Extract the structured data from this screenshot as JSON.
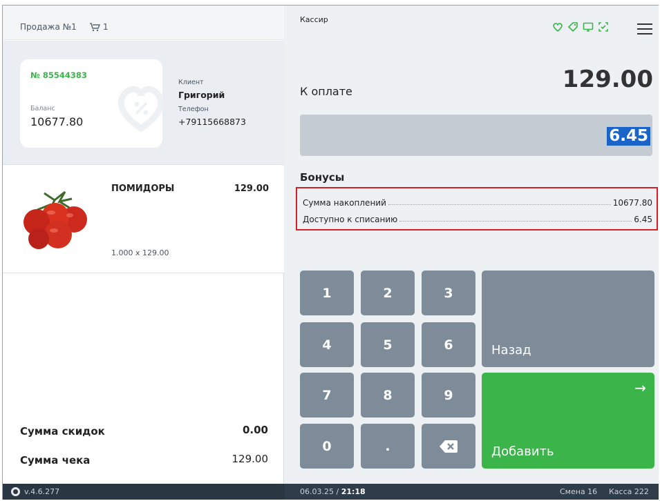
{
  "left": {
    "sale_title": "Продажа №1",
    "cart_count": "1",
    "card": {
      "number": "№ 85544383",
      "balance_label": "Баланс",
      "balance": "10677.80"
    },
    "client": {
      "label": "Клиент",
      "name": "Григорий",
      "phone_label": "Телефон",
      "phone": "+79115668873"
    },
    "item": {
      "name": "ПОМИДОРЫ",
      "price": "129.00",
      "qty": "1.000 x 129.00"
    },
    "sum_discount_label": "Сумма скидок",
    "sum_discount_value": "0.00",
    "sum_check_label": "Сумма чека",
    "sum_check_value": "129.00"
  },
  "right": {
    "cashier": "Кассир",
    "pay_label": "К оплате",
    "pay_total": "129.00",
    "bonus_input": "6.45",
    "bonuses_title": "Бонусы",
    "accum_label": "Сумма накоплений",
    "accum_value": "10677.80",
    "avail_label": "Доступно к списанию",
    "avail_value": "6.45",
    "keys": [
      "1",
      "2",
      "3",
      "4",
      "5",
      "6",
      "7",
      "8",
      "9",
      "0",
      "."
    ],
    "back_label": "Назад",
    "add_label": "Добавить"
  },
  "footer": {
    "version": "v.4.6.277",
    "date": "06.03.25 / ",
    "time": "21:18",
    "shift": "Смена 16",
    "kassa": "Касса 222"
  },
  "colors": {
    "accent_green": "#3bb44a",
    "key_gray": "#7e8c9a",
    "highlight_red": "#d91f26",
    "selection_blue": "#1a63c9"
  },
  "icons": [
    "cart-icon",
    "heart-icon",
    "tag-icon",
    "monitor-icon",
    "scan-icon",
    "menu-icon",
    "backspace-icon",
    "arrow-right-icon",
    "app-logo-icon"
  ]
}
